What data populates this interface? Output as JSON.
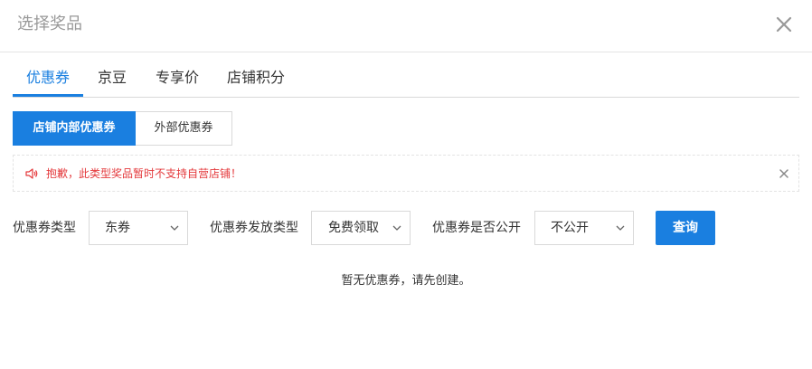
{
  "dialog": {
    "title": "选择奖品"
  },
  "tabs": [
    {
      "label": "优惠券",
      "active": true
    },
    {
      "label": "京豆",
      "active": false
    },
    {
      "label": "专享价",
      "active": false
    },
    {
      "label": "店铺积分",
      "active": false
    }
  ],
  "coupon_source": {
    "internal_label": "店铺内部优惠券",
    "external_label": "外部优惠券",
    "selected": "店铺内部优惠券"
  },
  "notice": {
    "icon": "speaker-icon",
    "text": "抱歉，此类型奖品暂时不支持自营店铺！",
    "color": "#e4393c"
  },
  "filters": {
    "coupon_type": {
      "label": "优惠券类型",
      "value": "东券"
    },
    "issue_type": {
      "label": "优惠券发放类型",
      "value": "免费领取"
    },
    "public": {
      "label": "优惠券是否公开",
      "value": "不公开"
    },
    "query_label": "查询"
  },
  "empty_message": "暂无优惠券，请先创建。",
  "colors": {
    "accent": "#1a7fe0",
    "warning": "#e4393c"
  }
}
